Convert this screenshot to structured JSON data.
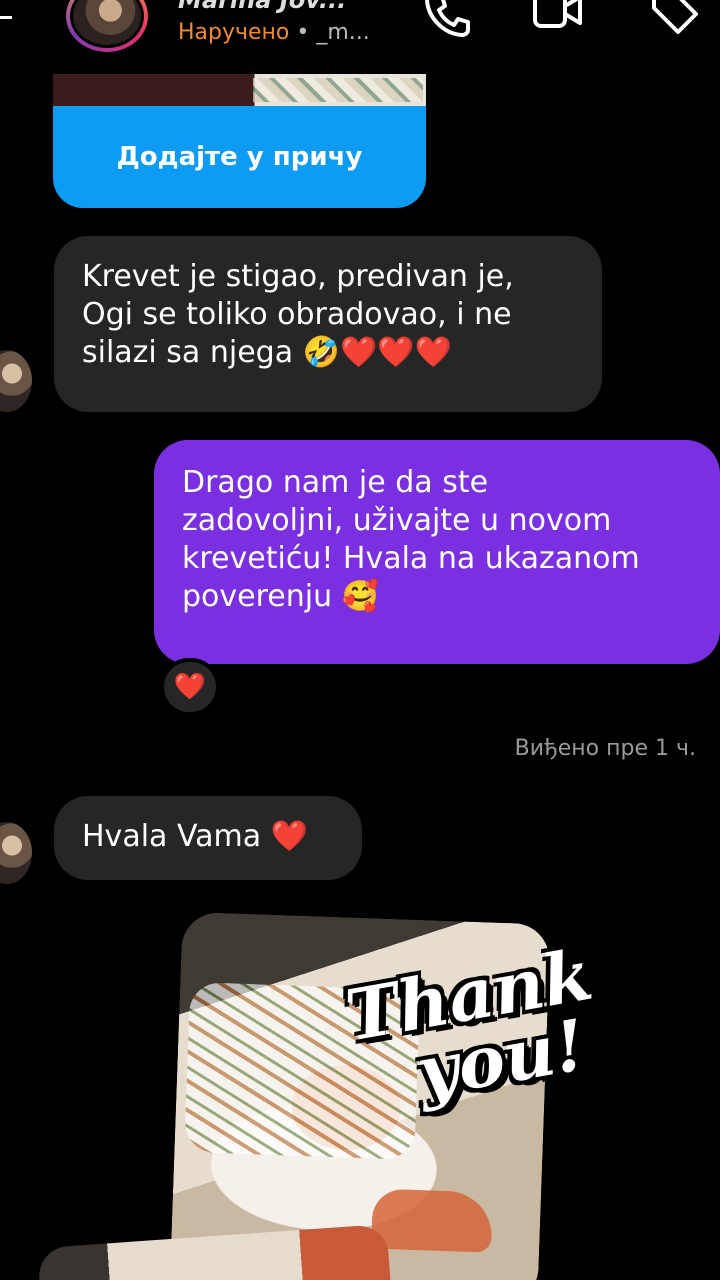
{
  "header": {
    "name": "Marina Jov...",
    "status": "Наручено",
    "separator": " • ",
    "handle": "_m...",
    "icons": [
      "phone-icon",
      "video-icon",
      "tag-icon"
    ]
  },
  "story": {
    "button_label": "Додајте у причу"
  },
  "messages": [
    {
      "from": "them",
      "text": "Krevet je stigao, predivan je,\nOgi se toliko obradovao, i ne\nsilazi sa njega 🤣❤️❤️❤️"
    },
    {
      "from": "me",
      "text": "Drago nam je da ste\nzadovoljni, uživajte u novom\nkrevetiću! Hvala na ukazanom\npoverenju 🥰",
      "reaction": "❤️"
    },
    {
      "from": "them",
      "text": "Hvala Vama ❤️"
    }
  ],
  "seen": "Виђено пре 1 ч.",
  "sticker": {
    "line1": "Thank",
    "line2": "you!"
  },
  "colors": {
    "background": "#000000",
    "incoming_bubble": "#262626",
    "outgoing_bubble": "#7a2fe0",
    "story_button": "#0d9bf3",
    "ordered_status": "#f28a2e"
  }
}
